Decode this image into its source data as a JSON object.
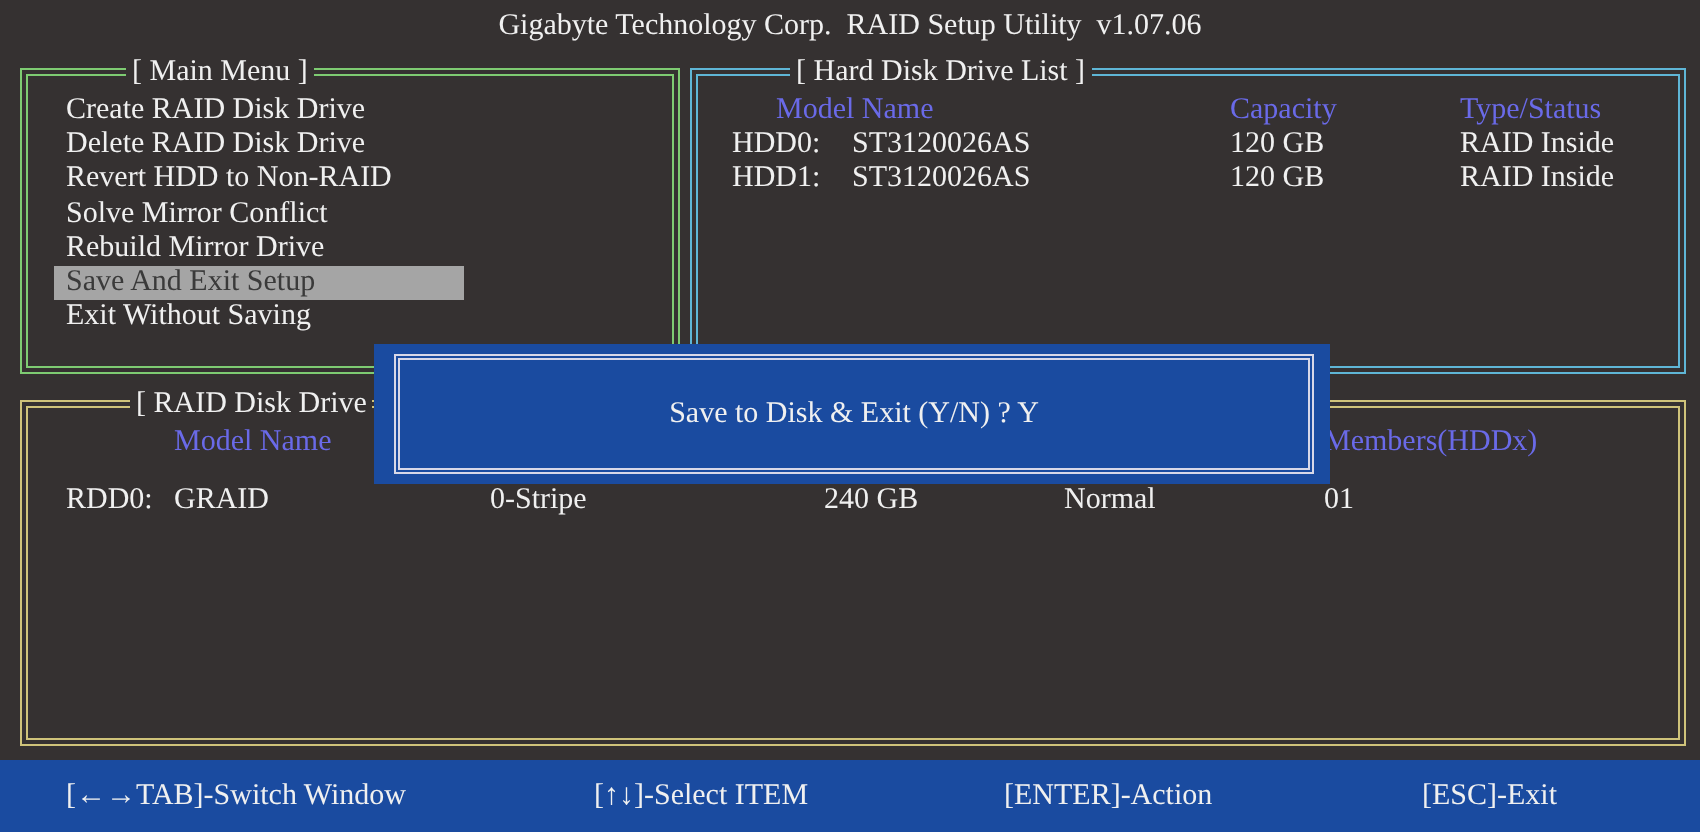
{
  "title": "Gigabyte Technology Corp.  RAID Setup Utility  v1.07.06",
  "main_menu": {
    "title": "[ Main Menu ]",
    "items": [
      {
        "label": "Create RAID Disk Drive",
        "selected": false
      },
      {
        "label": "Delete RAID Disk Drive",
        "selected": false
      },
      {
        "label": "Revert HDD to Non-RAID",
        "selected": false
      },
      {
        "label": "Solve Mirror Conflict",
        "selected": false
      },
      {
        "label": "Rebuild Mirror Drive",
        "selected": false
      },
      {
        "label": "Save And Exit Setup",
        "selected": true
      },
      {
        "label": "Exit Without Saving",
        "selected": false
      }
    ]
  },
  "hdd_list": {
    "title": "[ Hard Disk Drive List ]",
    "columns": [
      "Model Name",
      "Capacity",
      "Type/Status"
    ],
    "rows": [
      {
        "id": "HDD0:",
        "model": "ST3120026AS",
        "capacity": "120 GB",
        "status": "RAID Inside"
      },
      {
        "id": "HDD1:",
        "model": "ST3120026AS",
        "capacity": "120 GB",
        "status": "RAID Inside"
      }
    ]
  },
  "raid_list": {
    "title": "[ RAID Disk Drive",
    "columns": {
      "model_name": "Model Name",
      "members": "Members(HDDx)"
    },
    "rows": [
      {
        "id": "RDD0:",
        "name": "GRAID",
        "column_3": "0-Stripe",
        "column_4": "240 GB",
        "column_5": "Normal",
        "members": "01"
      }
    ]
  },
  "dialog": {
    "message": "Save to Disk & Exit (Y/N) ? Y"
  },
  "status_bar": [
    "[←→TAB]-Switch Window",
    "[↑↓]-Select ITEM",
    "[ENTER]-Action",
    "[ESC]-Exit"
  ]
}
